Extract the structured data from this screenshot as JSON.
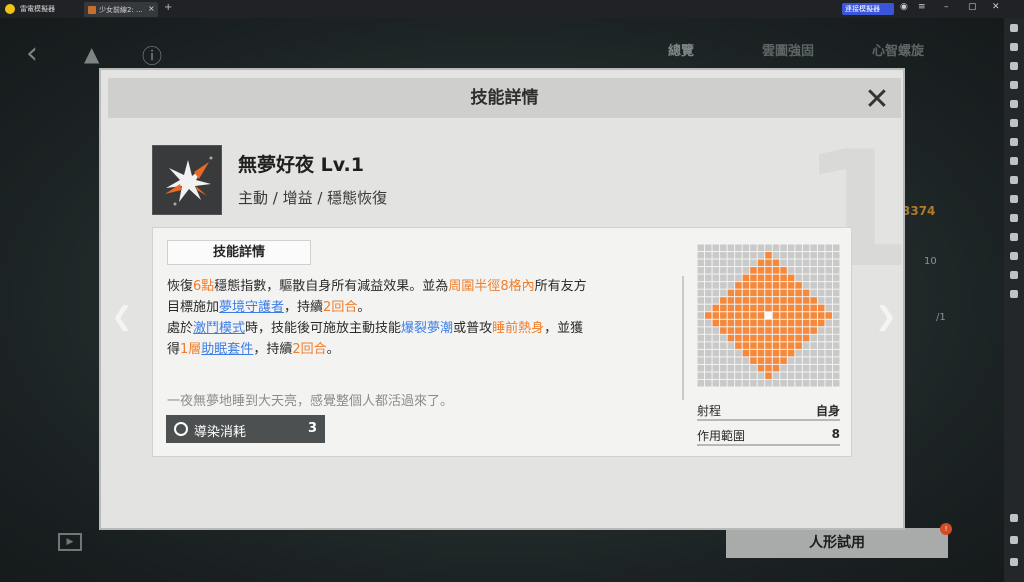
{
  "emulator": {
    "app_name": "雷電模擬器",
    "tab_title": "少女前線2: ...",
    "connect_label": "連接模擬器"
  },
  "background": {
    "tabs": [
      "總覽",
      "雲圖強固",
      "心智螺旋"
    ],
    "number": "3374",
    "count_a": "10",
    "count_b": "/1",
    "trial_button": "人形試用",
    "notification_badge": "!"
  },
  "modal": {
    "title": "技能詳情",
    "watermark": "1",
    "skill_name": "無夢好夜 Lv.1",
    "skill_tags": "主動 / 增益 / 穩態恢復",
    "tab_label": "技能詳情",
    "description": {
      "line1_parts": [
        "恢復",
        "6點",
        "穩態指數，驅散自身所有減益效果。並為",
        "周圍半徑8格內",
        "所有友方"
      ],
      "line2_parts": [
        "目標施加",
        "夢境守護者",
        "，持續",
        "2回合",
        "。"
      ],
      "line3_parts": [
        "處於",
        "激鬥模式",
        "時，技能後可施放主動技能",
        "爆裂夢潮",
        "或普攻",
        "睡前熱身",
        "，並獲"
      ],
      "line4_parts": [
        "得",
        "1層",
        "助眠套件",
        "，持續",
        "2回合",
        "。"
      ]
    },
    "flavor_text": "一夜無夢地睡到大天亮，感覺整個人都活過來了。",
    "cost": {
      "label": "導染消耗",
      "value": "3"
    },
    "stats": [
      {
        "key": "射程",
        "value": "自身"
      },
      {
        "key": "作用範圍",
        "value": "8"
      }
    ],
    "range_radius": 8,
    "colors": {
      "highlight": "#f07d2a",
      "link": "#3d7ee6",
      "grid_active": "#f5883a",
      "grid_inactive": "#c9c9c9"
    }
  }
}
